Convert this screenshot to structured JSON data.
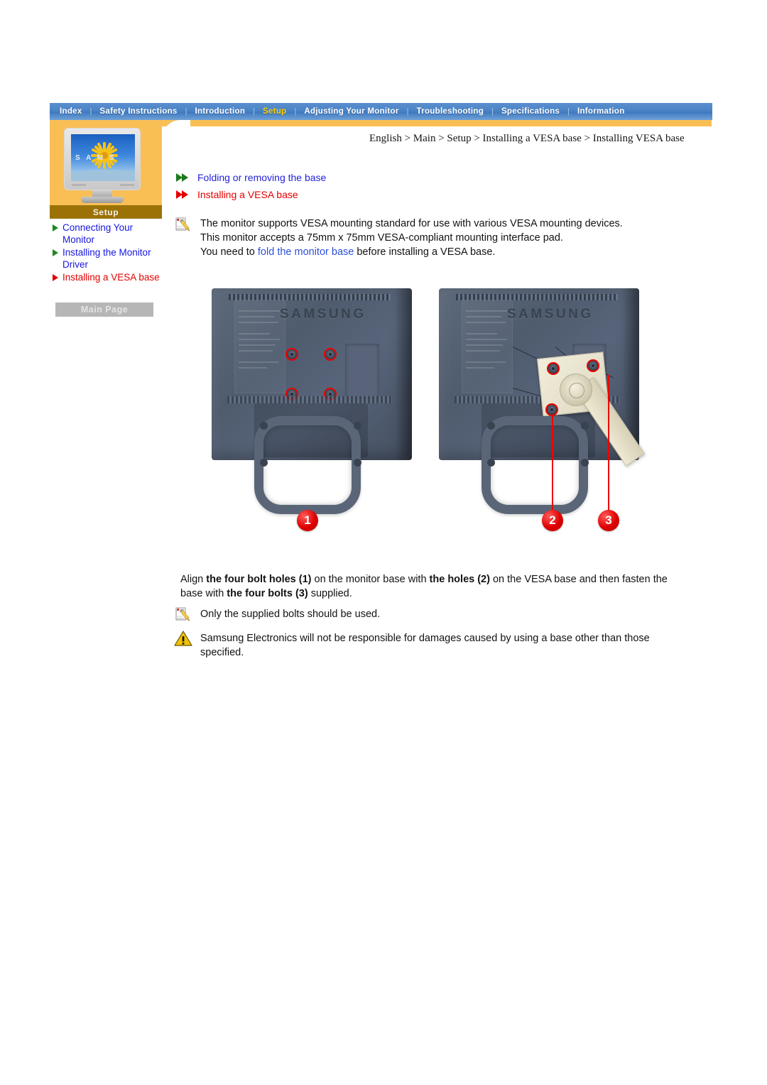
{
  "nav": {
    "items": [
      {
        "label": "Index",
        "active": false
      },
      {
        "label": "Safety Instructions",
        "active": false
      },
      {
        "label": "Introduction",
        "active": false
      },
      {
        "label": "Setup",
        "active": true
      },
      {
        "label": "Adjusting Your Monitor",
        "active": false
      },
      {
        "label": "Troubleshooting",
        "active": false
      },
      {
        "label": "Specifications",
        "active": false
      },
      {
        "label": "Information",
        "active": false
      }
    ],
    "separator": "|"
  },
  "sidebar": {
    "icon_name": "monitor-sunflower-icon",
    "icon_screen_text": "S A M S",
    "banner_label": "Setup",
    "items": [
      {
        "label": "Connecting Your Monitor",
        "state": "link"
      },
      {
        "label": "Installing the Monitor Driver",
        "state": "link"
      },
      {
        "label": "Installing a VESA base",
        "state": "current"
      }
    ],
    "main_page_label": "Main Page"
  },
  "breadcrumb": {
    "text": "English > Main > Setup > Installing a VESA base > Installing VESA base"
  },
  "section_links": [
    {
      "label": "Folding or removing the base",
      "state": "link"
    },
    {
      "label": "Installing a VESA base",
      "state": "current"
    }
  ],
  "intro": {
    "icon_name": "note-pencil-icon",
    "line1": "The monitor supports VESA mounting standard for use with various VESA mounting devices.",
    "line2": "This monitor accepts a 75mm x 75mm VESA-compliant mounting interface pad.",
    "line3_prefix": "You need to ",
    "line3_link": "fold the monitor base",
    "line3_suffix": " before installing a VESA base."
  },
  "figures": {
    "left": {
      "name": "monitor-rear-with-bolt-holes",
      "brand": "SAMSUNG",
      "callout": "1",
      "holes": 4
    },
    "right": {
      "name": "monitor-rear-with-vesa-base",
      "brand": "SAMSUNG",
      "callouts": [
        "2",
        "3"
      ],
      "holes": 3
    }
  },
  "instructions": {
    "p1_a": "Align ",
    "p1_b": "the four bolt holes",
    "p1_c": " (1)",
    "p1_d": " on the monitor base with ",
    "p1_e": "the holes",
    "p1_f": " (2)",
    "p1_g": " on the VESA base and then fasten the base with ",
    "p1_h": "the four bolts",
    "p1_i": " (3)",
    "p1_j": " supplied."
  },
  "notes": [
    {
      "icon_name": "note-pencil-icon",
      "text": "Only the supplied bolts should be used."
    },
    {
      "icon_name": "warning-triangle-icon",
      "text": "Samsung Electronics will not be responsible for damages caused by using a base other than those specified."
    }
  ],
  "colors": {
    "nav_blue": "#4a83c6",
    "nav_active": "#ffd100",
    "panel_orange": "#f9bf55",
    "banner_brown": "#9c7207",
    "link_blue": "#1616e0",
    "current_red": "#e00000",
    "callout_red": "#e00000"
  }
}
